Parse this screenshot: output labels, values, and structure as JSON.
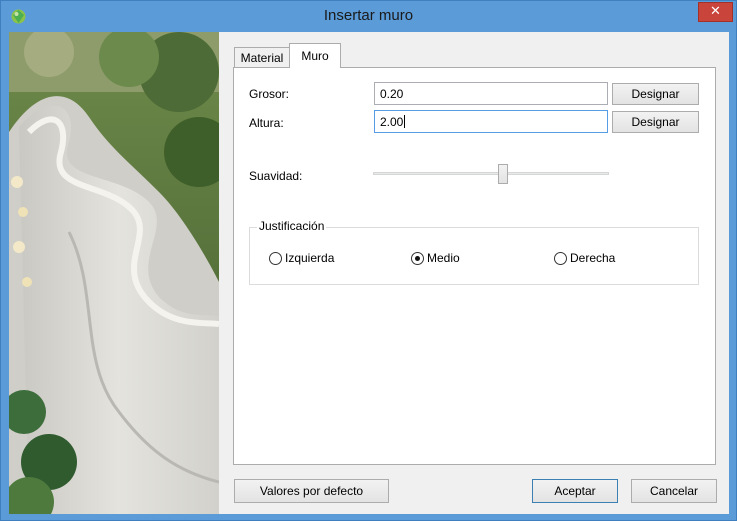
{
  "window": {
    "title": "Insertar muro",
    "close_glyph": "✕",
    "accent": "#5b9bd8",
    "close_color": "#c9443a"
  },
  "tabs": [
    {
      "label": "Material",
      "active": false
    },
    {
      "label": "Muro",
      "active": true
    }
  ],
  "form": {
    "grosor_label": "Grosor:",
    "grosor_value": "0.20",
    "altura_label": "Altura:",
    "altura_value": "2.00",
    "designar_label": "Designar",
    "suavidad_label": "Suavidad:",
    "suavidad_level": 0.55
  },
  "justificacion": {
    "title": "Justificación",
    "options": [
      {
        "label": "Izquierda",
        "checked": false
      },
      {
        "label": "Medio",
        "checked": true
      },
      {
        "label": "Derecha",
        "checked": false
      }
    ]
  },
  "footer": {
    "defaults_label": "Valores por defecto",
    "accept_label": "Aceptar",
    "cancel_label": "Cancelar"
  },
  "icons": {
    "app": "app-icon",
    "close": "close-icon"
  }
}
